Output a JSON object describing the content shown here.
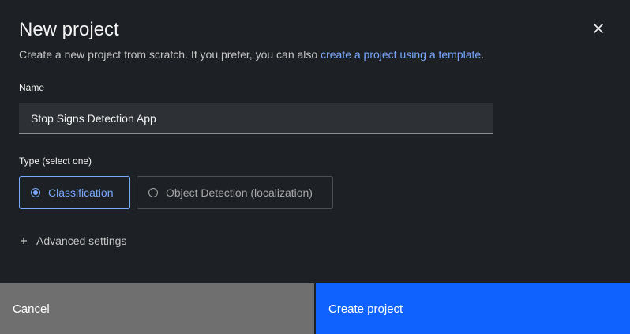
{
  "modal": {
    "title": "New project",
    "subtitle_text": "Create a new project from scratch. If you prefer, you can also ",
    "subtitle_link": "create a project using a template",
    "subtitle_end": ".",
    "close_icon": "close-icon"
  },
  "name_field": {
    "label": "Name",
    "value": "Stop Signs Detection App"
  },
  "type_field": {
    "label": "Type (select one)",
    "options": [
      {
        "label": "Classification",
        "selected": true
      },
      {
        "label": "Object Detection (localization)",
        "selected": false
      }
    ]
  },
  "advanced": {
    "label": "Advanced settings",
    "icon": "plus-icon"
  },
  "footer": {
    "cancel_label": "Cancel",
    "create_label": "Create project"
  },
  "colors": {
    "background": "#1d2024",
    "accent": "#78a9ff",
    "primary_button": "#0f62fe",
    "secondary_button": "#6f6f6f"
  }
}
